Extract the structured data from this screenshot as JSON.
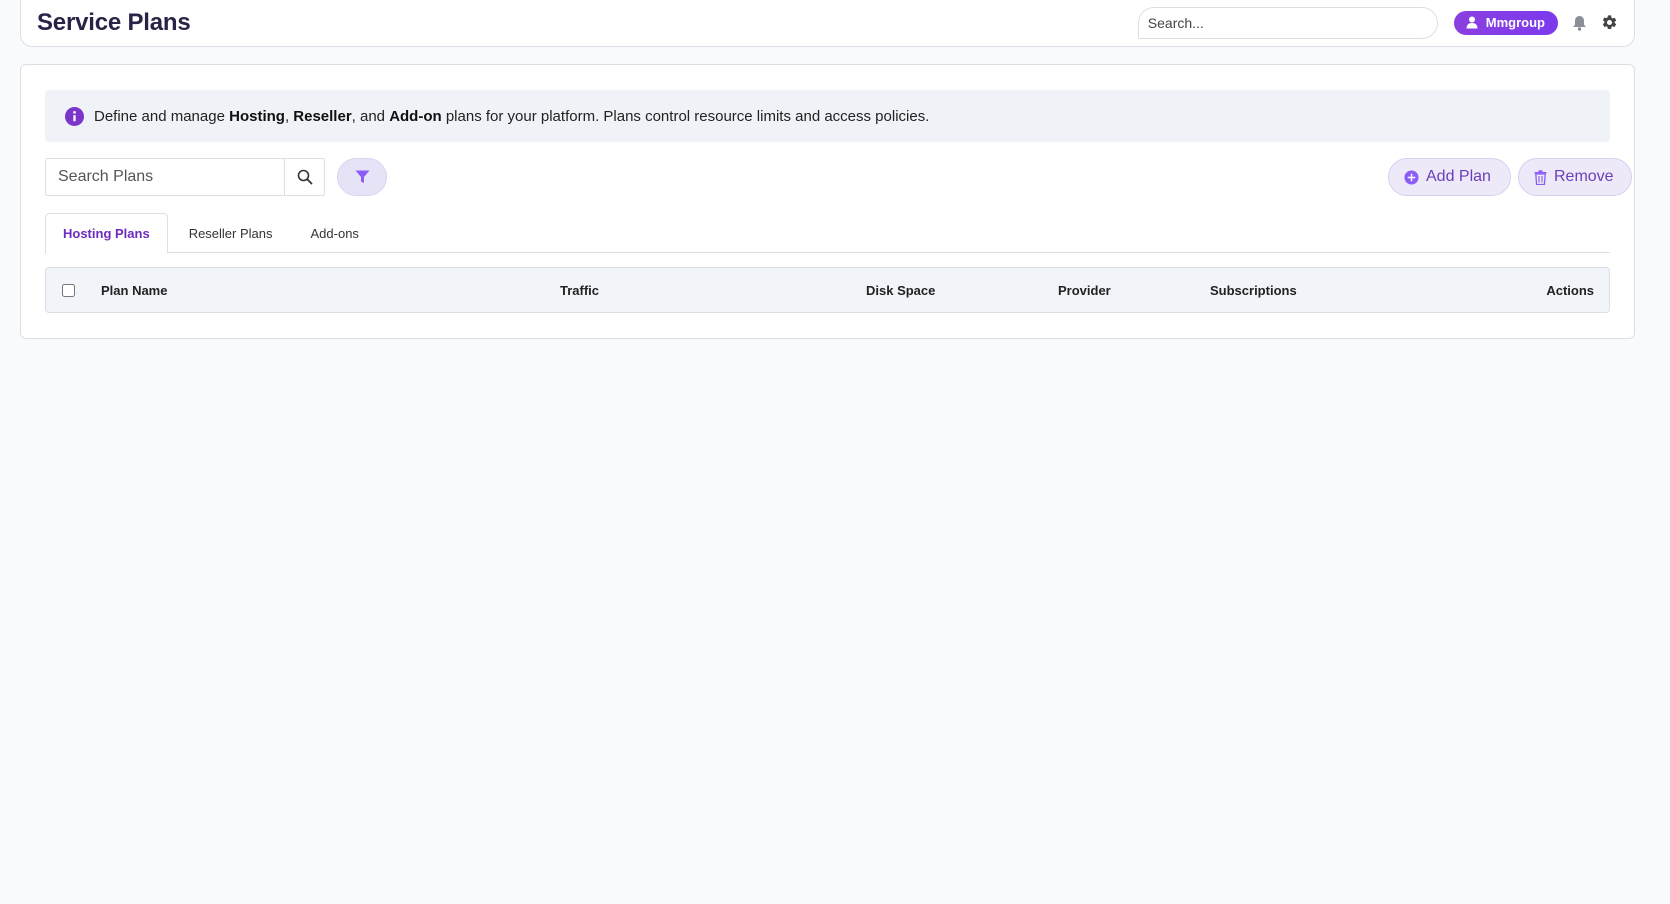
{
  "header": {
    "title": "Service Plans",
    "search_placeholder": "Search...",
    "user_label": "Mmgroup"
  },
  "info": {
    "part1": "Define and manage ",
    "hosting": "Hosting",
    "sep1": ", ",
    "reseller": "Reseller",
    "sep2": ", and ",
    "addon": "Add-on",
    "part2": " plans for your platform. Plans control resource limits and access policies."
  },
  "toolbar": {
    "search_placeholder": "Search Plans",
    "add_label": "Add Plan",
    "remove_label": "Remove"
  },
  "tabs": [
    {
      "label": "Hosting Plans",
      "active": true
    },
    {
      "label": "Reseller Plans",
      "active": false
    },
    {
      "label": "Add-ons",
      "active": false
    }
  ],
  "table": {
    "columns": [
      "Plan Name",
      "Traffic",
      "Disk Space",
      "Provider",
      "Subscriptions",
      "Actions"
    ],
    "rows": []
  },
  "colors": {
    "accent": "#7c3aed",
    "title": "#2b2347",
    "background": "#f9fafb"
  }
}
